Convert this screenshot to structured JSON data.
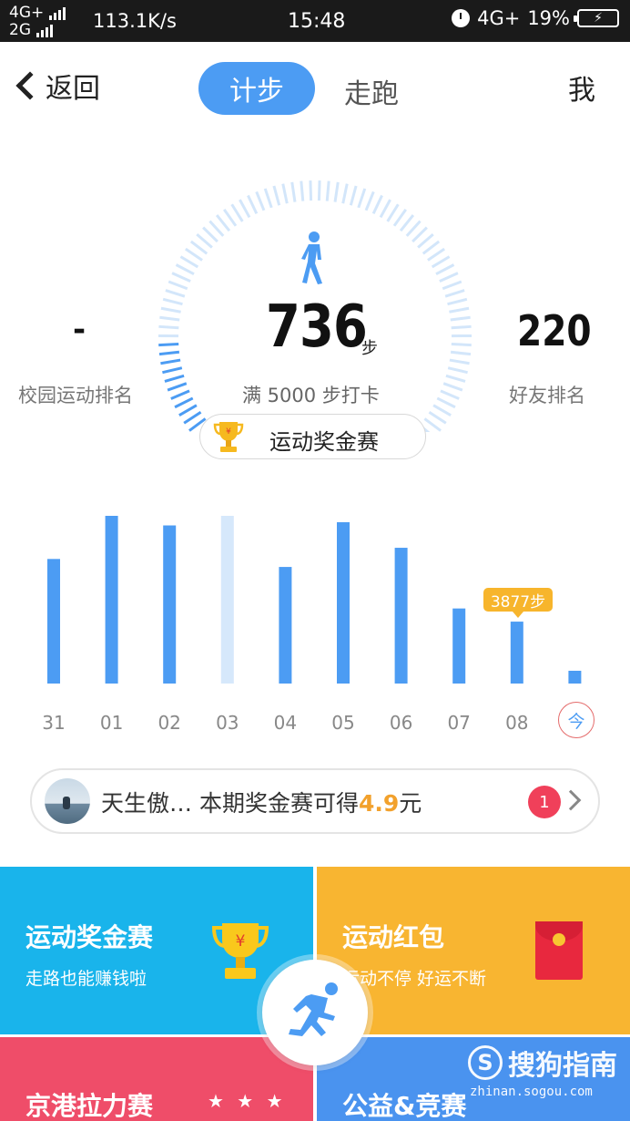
{
  "status_bar": {
    "net_top": "4G+",
    "net_bottom": "2G",
    "speed": "113.1K/s",
    "time": "15:48",
    "net_right": "4G+",
    "battery_pct": "19%"
  },
  "header": {
    "back_label": "返回",
    "tab_step": "计步",
    "tab_run": "走跑",
    "me_label": "我"
  },
  "summary": {
    "steps": "736",
    "steps_unit": "步",
    "goal": "满 5000 步打卡",
    "campus_rank_value": "-",
    "campus_rank_label": "校园运动排名",
    "friend_rank_value": "220",
    "friend_rank_label": "好友排名",
    "contest_label": "运动奖金赛"
  },
  "chart_data": {
    "type": "bar",
    "categories": [
      "31",
      "01",
      "02",
      "03",
      "04",
      "05",
      "06",
      "07",
      "08",
      "今"
    ],
    "values": [
      7800,
      10500,
      9900,
      10500,
      7300,
      10100,
      8500,
      4700,
      3877,
      800
    ],
    "highlight_light_index": 3,
    "tooltip_index": 8,
    "tooltip": "3877步",
    "colors": {
      "bar": "#4c9cf3",
      "bar_light": "#d6e8fb",
      "tooltip": "#f7b52c"
    }
  },
  "ranking": {
    "name": "天生傲…",
    "text": "本期奖金赛可得",
    "amount": "4.9",
    "unit": "元",
    "badge": "1"
  },
  "tiles": [
    {
      "title": "运动奖金赛",
      "subtitle": "走路也能赚钱啦"
    },
    {
      "title": "运动红包",
      "subtitle": "运动不停 好运不断"
    },
    {
      "title": "京港拉力赛",
      "subtitle": ""
    },
    {
      "title": "公益&竞赛",
      "subtitle": ""
    }
  ],
  "watermark": {
    "logo_letter": "S",
    "name": "搜狗指南",
    "url": "zhinan.sogou.com"
  },
  "colors": {
    "accent": "#4c9cf3",
    "tile_blue": "#19b4eb",
    "tile_orange": "#f8b531",
    "tile_red": "#ef4d69",
    "tile_blue2": "#4a93ef"
  }
}
